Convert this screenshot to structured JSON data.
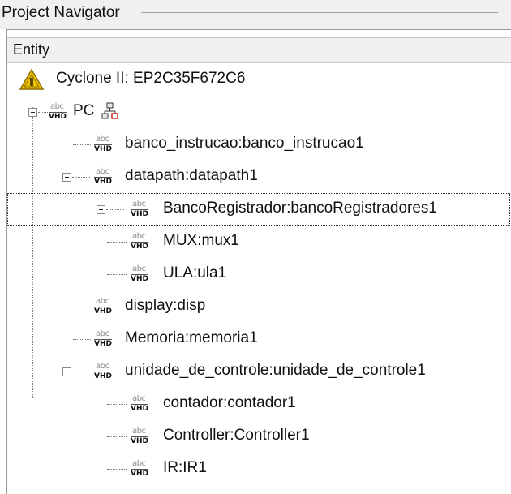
{
  "panel": {
    "title": "Project Navigator"
  },
  "table": {
    "header": "Entity"
  },
  "device": {
    "label": "Cyclone II: EP2C35F672C6",
    "icon": "warning-icon"
  },
  "file_icon": {
    "top": "abc",
    "bottom": "VHD"
  },
  "tree": [
    {
      "label": "PC",
      "icon": "hierarchy-icon"
    },
    {
      "label": "banco_instrucao:banco_instrucao1"
    },
    {
      "label": "datapath:datapath1"
    },
    {
      "label": "BancoRegistrador:bancoRegistradores1",
      "selected": true
    },
    {
      "label": "MUX:mux1"
    },
    {
      "label": "ULA:ula1"
    },
    {
      "label": "display:disp"
    },
    {
      "label": "Memoria:memoria1"
    },
    {
      "label": "unidade_de_controle:unidade_de_controle1"
    },
    {
      "label": "contador:contador1"
    },
    {
      "label": "Controller:Controller1"
    },
    {
      "label": "IR:IR1"
    }
  ],
  "colors": {
    "warning": "#f2c400",
    "hierarchy": "#c62828",
    "selection": "#333333"
  }
}
